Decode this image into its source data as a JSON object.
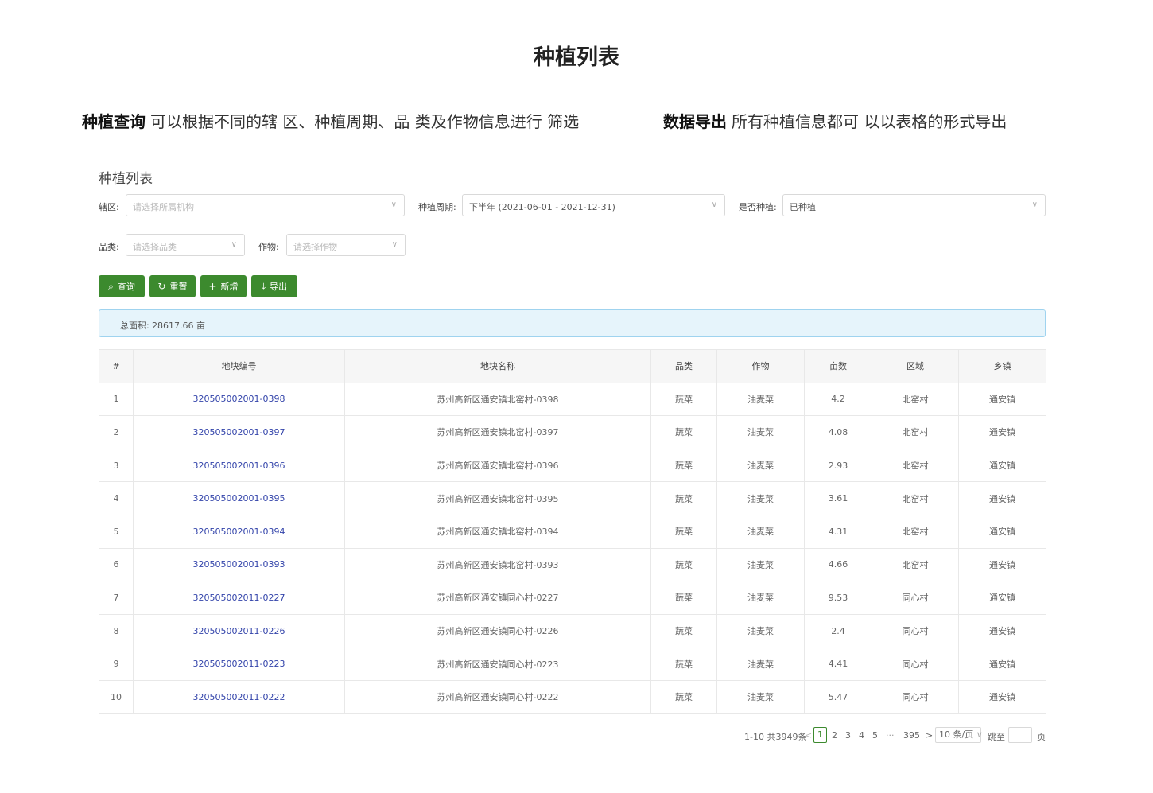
{
  "hero": {
    "title": "种植列表",
    "left_bold": "种植查询",
    "left_text": "可以根据不同的辖 区、种植周期、品 类及作物信息进行 筛选",
    "right_bold": "数据导出",
    "right_text": "所有种植信息都可 以以表格的形式导出"
  },
  "panel": {
    "title": "种植列表",
    "filters": {
      "district": {
        "label": "辖区:",
        "placeholder": "请选择所属机构"
      },
      "period": {
        "label": "种植周期:",
        "value": "下半年 (2021-06-01 - 2021-12-31)"
      },
      "planted": {
        "label": "是否种植:",
        "value": "已种植"
      },
      "category": {
        "label": "品类:",
        "placeholder": "请选择品类"
      },
      "crop": {
        "label": "作物:",
        "placeholder": "请选择作物"
      }
    },
    "buttons": {
      "query": "查询",
      "reset": "重置",
      "add": "新增",
      "export": "导出"
    },
    "summary": {
      "label": "总面积:",
      "value": "28617.66 亩"
    },
    "table": {
      "headers": [
        "#",
        "地块编号",
        "地块名称",
        "品类",
        "作物",
        "亩数",
        "区域",
        "乡镇"
      ],
      "rows": [
        [
          "1",
          "320505002001-0398",
          "苏州高新区通安镇北窑村-0398",
          "蔬菜",
          "油麦菜",
          "4.2",
          "北窑村",
          "通安镇"
        ],
        [
          "2",
          "320505002001-0397",
          "苏州高新区通安镇北窑村-0397",
          "蔬菜",
          "油麦菜",
          "4.08",
          "北窑村",
          "通安镇"
        ],
        [
          "3",
          "320505002001-0396",
          "苏州高新区通安镇北窑村-0396",
          "蔬菜",
          "油麦菜",
          "2.93",
          "北窑村",
          "通安镇"
        ],
        [
          "4",
          "320505002001-0395",
          "苏州高新区通安镇北窑村-0395",
          "蔬菜",
          "油麦菜",
          "3.61",
          "北窑村",
          "通安镇"
        ],
        [
          "5",
          "320505002001-0394",
          "苏州高新区通安镇北窑村-0394",
          "蔬菜",
          "油麦菜",
          "4.31",
          "北窑村",
          "通安镇"
        ],
        [
          "6",
          "320505002001-0393",
          "苏州高新区通安镇北窑村-0393",
          "蔬菜",
          "油麦菜",
          "4.66",
          "北窑村",
          "通安镇"
        ],
        [
          "7",
          "320505002011-0227",
          "苏州高新区通安镇同心村-0227",
          "蔬菜",
          "油麦菜",
          "9.53",
          "同心村",
          "通安镇"
        ],
        [
          "8",
          "320505002011-0226",
          "苏州高新区通安镇同心村-0226",
          "蔬菜",
          "油麦菜",
          "2.4",
          "同心村",
          "通安镇"
        ],
        [
          "9",
          "320505002011-0223",
          "苏州高新区通安镇同心村-0223",
          "蔬菜",
          "油麦菜",
          "4.41",
          "同心村",
          "通安镇"
        ],
        [
          "10",
          "320505002011-0222",
          "苏州高新区通安镇同心村-0222",
          "蔬菜",
          "油麦菜",
          "5.47",
          "同心村",
          "通安镇"
        ]
      ]
    },
    "pagination": {
      "range": "1-10 共3949条",
      "prev": "<",
      "pages": [
        "1",
        "2",
        "3",
        "4",
        "5"
      ],
      "current": "1",
      "ellipsis": "···",
      "last": "395",
      "next": ">",
      "page_size": "10 条/页",
      "jump_label": "跳至",
      "page_suffix": "页"
    }
  },
  "colors": {
    "primary": "#3c8a2e",
    "link": "#3344aa",
    "info_bg": "#e6f4fb",
    "info_border": "#9fd3ef"
  },
  "icons": {
    "query": "search-icon",
    "reset": "refresh-icon",
    "add": "plus-icon",
    "export": "download-icon"
  }
}
